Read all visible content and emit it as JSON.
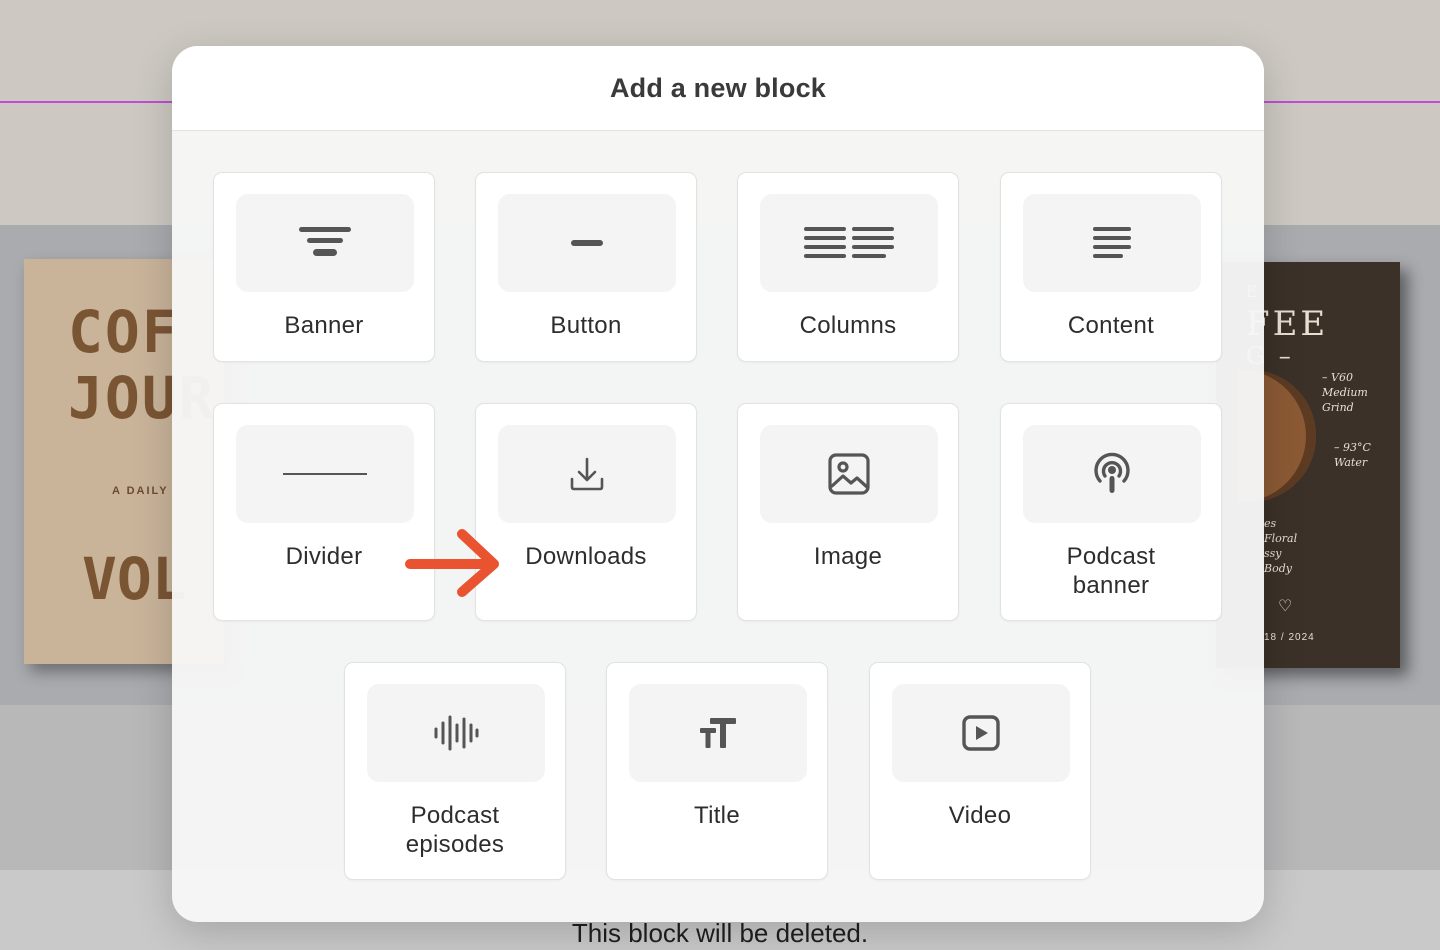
{
  "modal": {
    "title": "Add a new block",
    "blocks": [
      {
        "label": "Banner",
        "icon": "banner-icon"
      },
      {
        "label": "Button",
        "icon": "button-icon"
      },
      {
        "label": "Columns",
        "icon": "columns-icon"
      },
      {
        "label": "Content",
        "icon": "content-icon"
      },
      {
        "label": "Divider",
        "icon": "divider-icon"
      },
      {
        "label": "Downloads",
        "icon": "download-icon"
      },
      {
        "label": "Image",
        "icon": "image-icon"
      },
      {
        "label": "Podcast\nbanner",
        "icon": "podcast-icon"
      },
      {
        "label": "Podcast\nepisodes",
        "icon": "audio-waveform-icon"
      },
      {
        "label": "Title",
        "icon": "text-size-icon"
      },
      {
        "label": "Video",
        "icon": "play-video-icon"
      }
    ]
  },
  "annotation": {
    "icon": "arrow-right-icon",
    "color": "#ea5330",
    "target": "Downloads"
  },
  "background": {
    "status_text": "This block will be deleted.",
    "book_left": {
      "title_line1": "COF",
      "title_line2": "JOUR",
      "subtitle": "A DAILY",
      "vol": "VOL"
    },
    "book_right": {
      "title_line1": "E",
      "title_line2": "FEE",
      "title_line3": "G –",
      "note1": "– V60\nMedium Grind",
      "note2": "– 93°C\nWater",
      "note3": "es\nFloral\nssy\nBody",
      "heart": "♡",
      "date": "18 / 2024"
    }
  },
  "colors": {
    "accent": "#ea5330",
    "guide": "#c34bd8",
    "icon": "#555555"
  }
}
